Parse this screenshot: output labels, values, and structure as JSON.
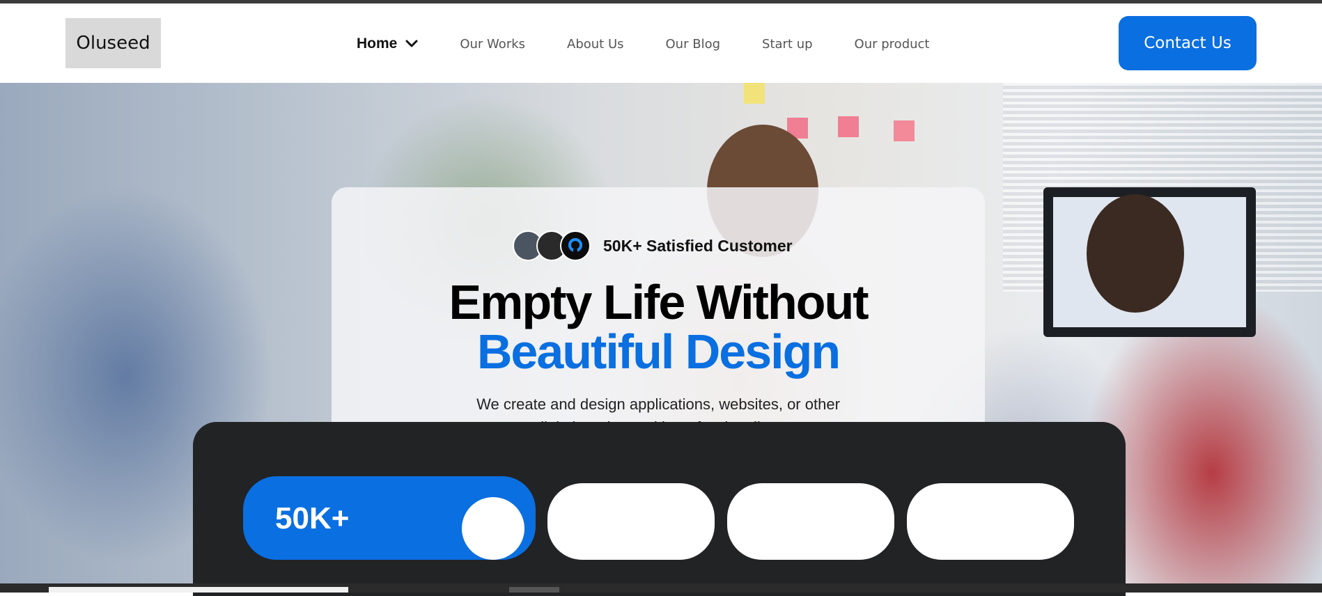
{
  "header": {
    "logo_text": "Oluseed",
    "nav": {
      "home_label": "Home",
      "links": [
        "Our Works",
        "About Us",
        "Our Blog",
        "Start up",
        "Our product"
      ]
    },
    "contact_label": "Contact Us"
  },
  "hero": {
    "customer_label": "50K+ Satisfied Customer",
    "headline_line1": "Empty Life Without",
    "headline_line2": "Beautiful Design",
    "subtext": "We create and design applications, websites, or other digital products with professionalism"
  },
  "stats": {
    "main_value": "50K+"
  },
  "colors": {
    "accent": "#0a6fe0",
    "panel_dark": "#222325",
    "heading": "#000000"
  }
}
